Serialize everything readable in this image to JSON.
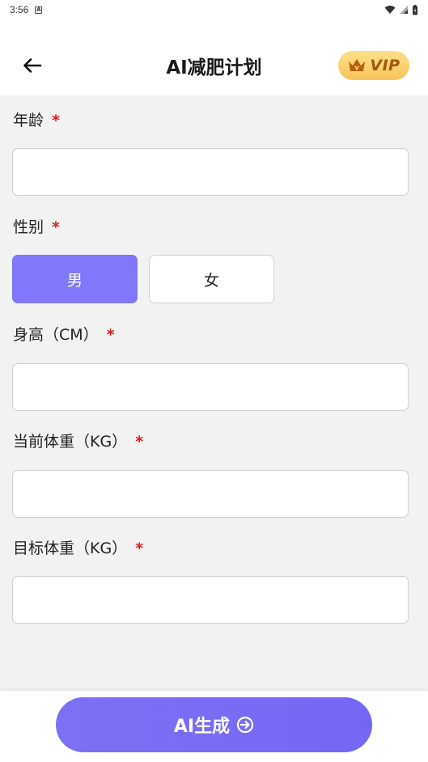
{
  "status_bar": {
    "time": "3:56",
    "notification": "A"
  },
  "header": {
    "title": "AI减肥计划",
    "vip_label": "VIP"
  },
  "form": {
    "age": {
      "label": "年龄",
      "required_mark": "*",
      "value": ""
    },
    "gender": {
      "label": "性别",
      "required_mark": "*",
      "options": [
        "男",
        "女"
      ],
      "selected": "男"
    },
    "height": {
      "label": "身高（CM）",
      "required_mark": "*",
      "value": ""
    },
    "current_weight": {
      "label": "当前体重（KG）",
      "required_mark": "*",
      "value": ""
    },
    "target_weight": {
      "label": "目标体重（KG）",
      "required_mark": "*",
      "value": ""
    }
  },
  "footer": {
    "generate_label": "AI生成"
  },
  "colors": {
    "accent": "#8077fa",
    "required": "#e01a1a",
    "vip_gold": "#f8c35a",
    "vip_text": "#a0570e"
  }
}
